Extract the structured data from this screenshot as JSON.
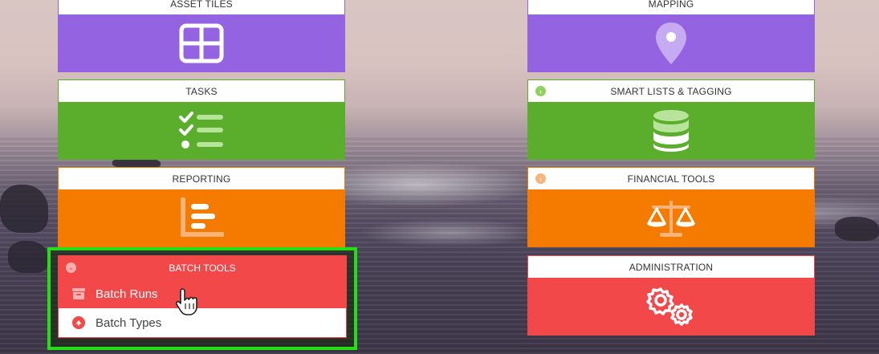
{
  "tiles_left": [
    {
      "title": "ASSET TILES",
      "icon": "grid-icon",
      "color": "#9463e2"
    },
    {
      "title": "TASKS",
      "icon": "checklist-icon",
      "color": "#5aae2b"
    },
    {
      "title": "REPORTING",
      "icon": "report-chart-icon",
      "color": "#f47b00"
    }
  ],
  "tiles_right": [
    {
      "title": "MAPPING",
      "icon": "map-pin-icon",
      "color": "#9463e2"
    },
    {
      "title": "SMART LISTS & TAGGING",
      "icon": "database-icon",
      "color": "#5aae2b"
    },
    {
      "title": "FINANCIAL TOOLS",
      "icon": "scales-icon",
      "color": "#f47b00"
    },
    {
      "title": "ADMINISTRATION",
      "icon": "gears-icon",
      "color": "#f2484a"
    }
  ],
  "batch_tools": {
    "title": "BATCH TOOLS",
    "items": [
      {
        "label": "Batch Runs",
        "icon": "archive-box-icon",
        "active": true
      },
      {
        "label": "Batch Types",
        "icon": "batch-types-icon",
        "active": false
      }
    ]
  },
  "colors": {
    "purple": "#9463e2",
    "green": "#5aae2b",
    "orange": "#f47b00",
    "red": "#f2484a",
    "highlight": "#22e015"
  }
}
